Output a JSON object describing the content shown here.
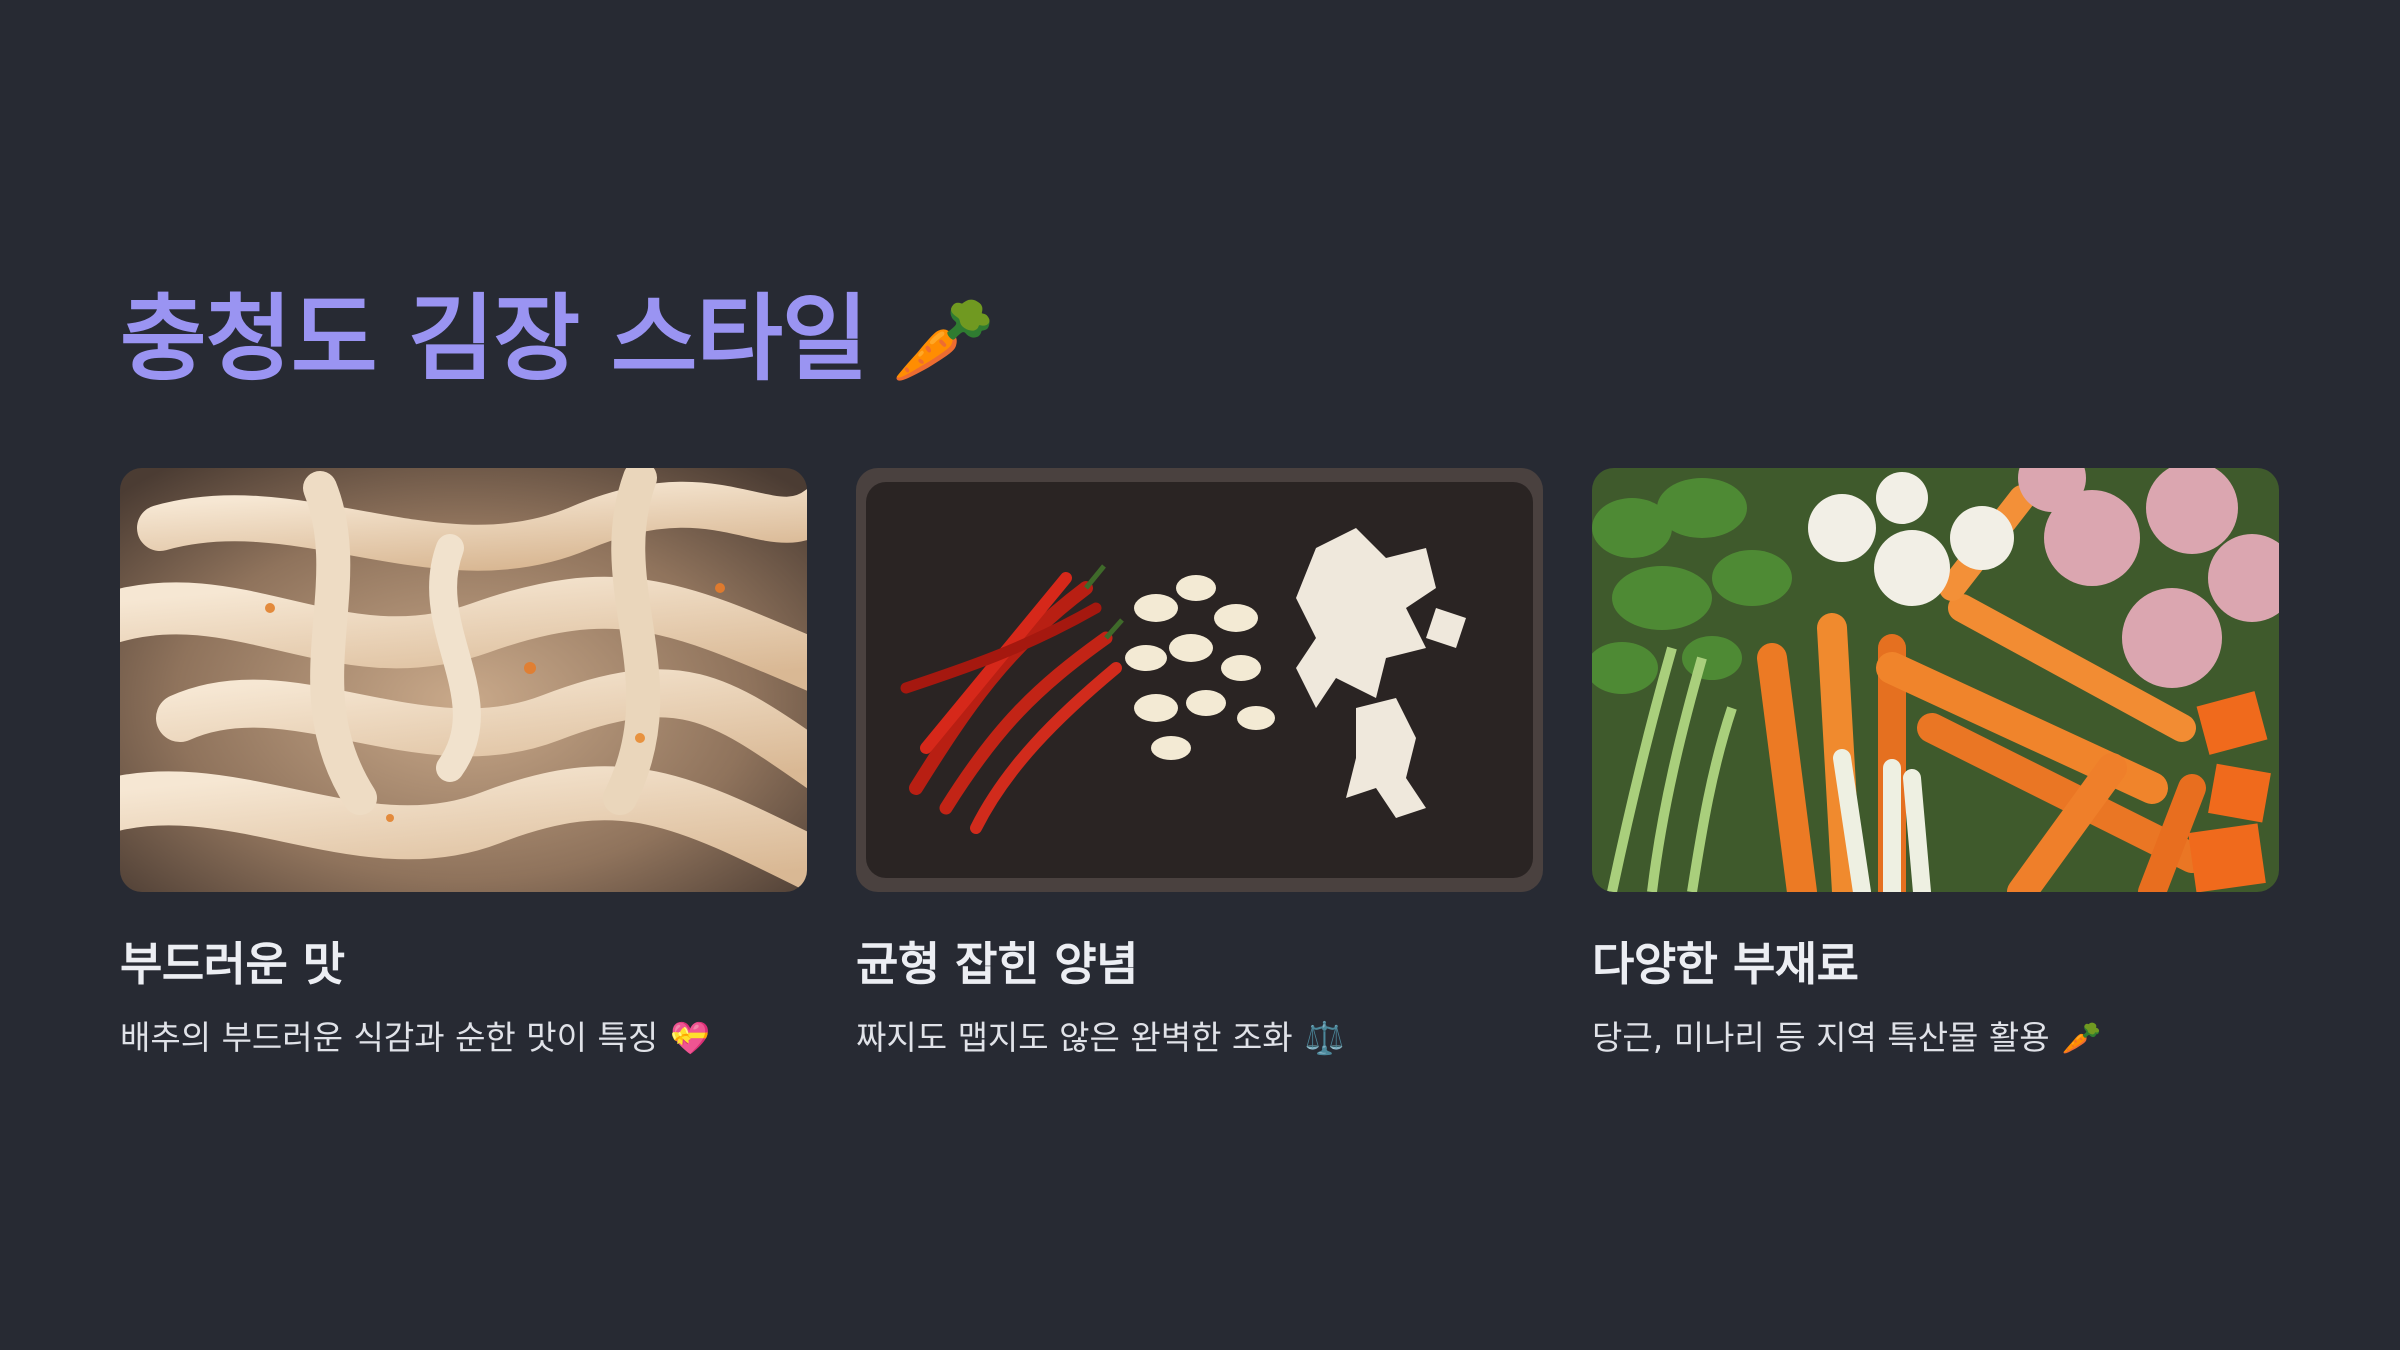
{
  "slide": {
    "title": "충청도 김장 스타일",
    "title_icon": "🥕",
    "title_color": "#9a94f2",
    "background": "#272a33"
  },
  "cards": [
    {
      "image": "cabbage-strips-photo",
      "title": "부드러운 맛",
      "description": "배추의 부드러운 식감과 순한 맛이 특징",
      "icon": "💝"
    },
    {
      "image": "chili-garlic-ginger-photo",
      "title": "균형 잡힌 양념",
      "description": "짜지도 맵지도 않은 완벽한 조화",
      "icon": "⚖️"
    },
    {
      "image": "carrots-onions-vegetables-photo",
      "title": "다양한 부재료",
      "description": "당근, 미나리 등 지역 특산물 활용",
      "icon": "🥕"
    }
  ]
}
